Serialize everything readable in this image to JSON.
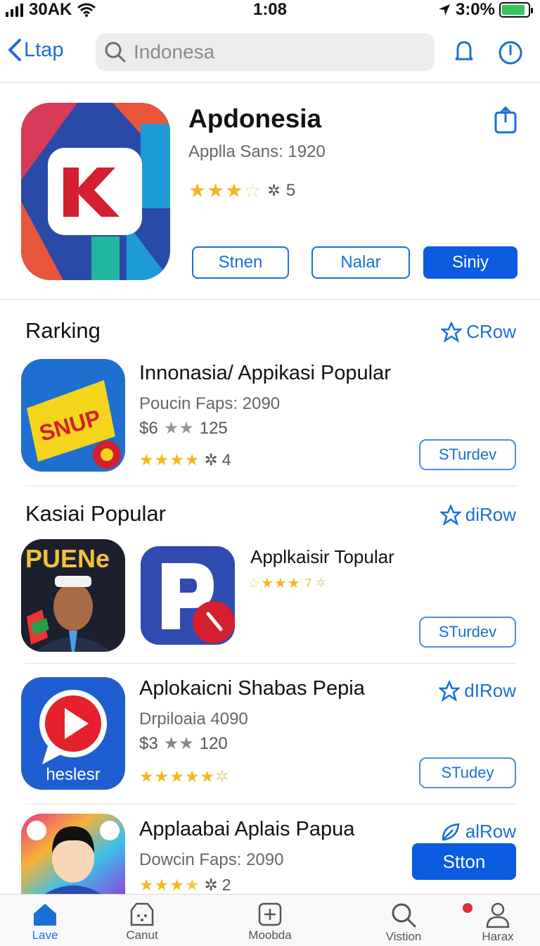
{
  "status_bar": {
    "carrier": "30AK",
    "time": "1:08",
    "battery": "3:0%",
    "battery_level": 0.9,
    "colors": {
      "battery": "#35c759"
    }
  },
  "nav": {
    "back_label": "Ltap",
    "search_value": "Indonesa",
    "icons": [
      "search-icon",
      "bell-icon",
      "clock-icon"
    ]
  },
  "hero": {
    "title": "Apdonesia",
    "subtitle": "Applla Sans: 1920",
    "stars": 3.5,
    "rating_text": "5",
    "buttons": {
      "first": "Stnen",
      "second": "Nalar",
      "third": "Siniy"
    }
  },
  "sections": [
    {
      "title": "Rarking",
      "link": "CRow",
      "apps": [
        {
          "title": "Innonasia/ Appikasi Popular",
          "subtitle": "Poucin Faps: 2090",
          "price": "$6",
          "price_count": "125",
          "stars": 4,
          "rating_text": "4",
          "action": "STurdev",
          "icon_text": "SNUP"
        }
      ]
    },
    {
      "title": "Kasiai Popular",
      "link": "diRow",
      "apps": [
        {
          "title": "Applkaisir Topular",
          "stars": 4,
          "rating_text": "7",
          "action": "STurdev",
          "icon_text_1": "PUENe",
          "icon_text_2": "P"
        }
      ]
    },
    {
      "title": "",
      "link": "dIRow",
      "apps": [
        {
          "title": "Aplokaicni  Shabas Pepia",
          "subtitle": "Drpiloaia 4090",
          "price": "$3",
          "price_count": "120",
          "stars": 4.5,
          "action": "STudey",
          "icon_text": "heslesr"
        }
      ]
    },
    {
      "title": "",
      "link": "alRow",
      "apps": [
        {
          "title": "Applaabai Aplais Papua",
          "subtitle": "Dowcin Faps: 2090",
          "stars": 4,
          "rating_text": "2",
          "action": "Stton"
        }
      ]
    }
  ],
  "tabbar": [
    {
      "label": "Lave",
      "icon": "home-icon",
      "active": true
    },
    {
      "label": "Canut",
      "icon": "dice-icon",
      "active": false
    },
    {
      "label": "Moobda",
      "icon": "plus-square-icon",
      "active": false
    },
    {
      "label": "Vistion",
      "icon": "search-icon",
      "active": false
    },
    {
      "label": "Harax",
      "icon": "person-icon",
      "active": false
    }
  ],
  "colors": {
    "accent": "#1a6fd8",
    "primary_button": "#0a5be0",
    "star": "#f2b91c",
    "badge": "#d9303a"
  }
}
